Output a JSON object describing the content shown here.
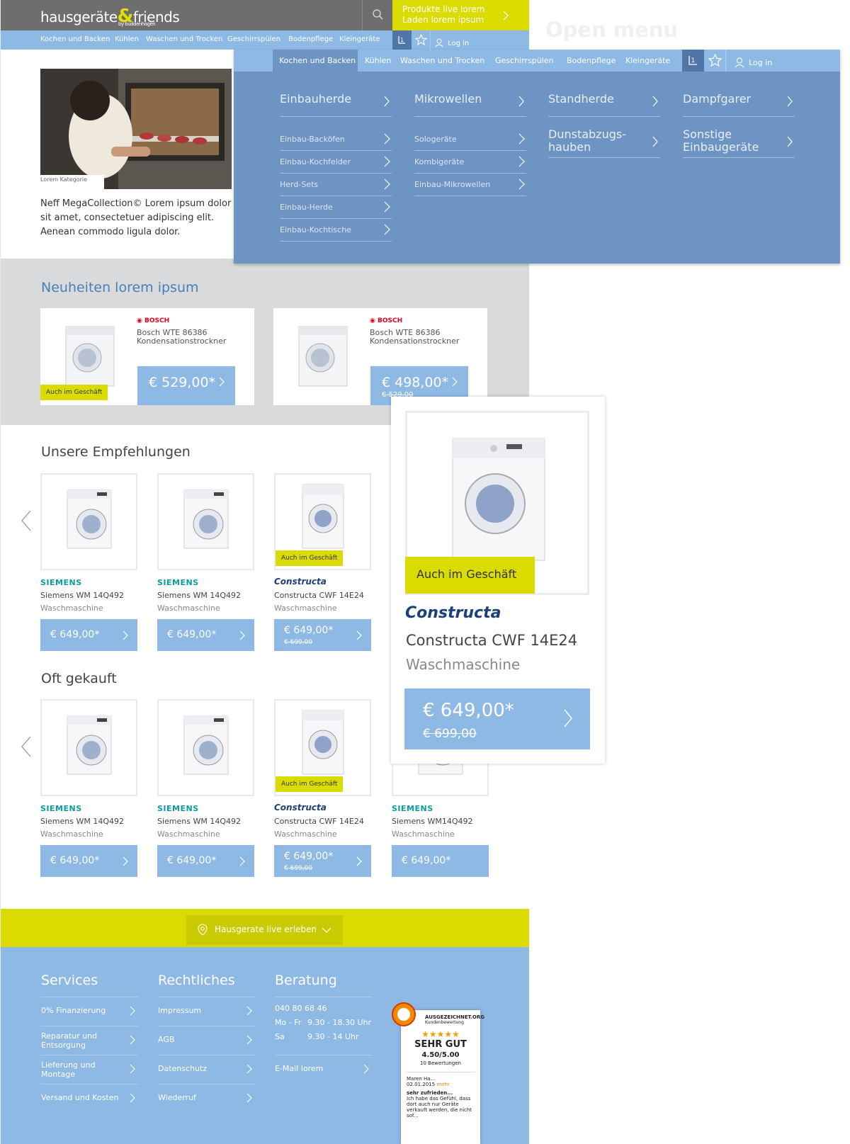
{
  "header": {
    "logo_main": "hausgeräte",
    "logo_amp": "&",
    "logo_friends": "friends",
    "logo_by": "by buddenhagen",
    "promo_line1": "Produkte live lorem",
    "promo_line2": "Laden lorem ipsum",
    "nav": [
      "Kochen und Backen",
      "Kühlen",
      "Waschen und Trocken",
      "Geschirrspülen",
      "Bodenpflege",
      "Kleingeräte"
    ],
    "login": "Log in"
  },
  "hero": {
    "caption": "Lorem Kategorie",
    "text": "Neff MegaCollection© Lorem ipsum dolor sit amet, consectetuer adipiscing elit. Aenean commodo ligula dolor."
  },
  "neuheiten": {
    "title": "Neuheiten lorem ipsum",
    "items": [
      {
        "brand": "BOSCH",
        "name": "Bosch WTE 86386",
        "type": "Kondensationstrockner",
        "price": "€ 529,00*",
        "old": "",
        "badge": "Auch im Geschäft"
      },
      {
        "brand": "BOSCH",
        "name": "Bosch WTE 86386",
        "type": "Kondensationstrockner",
        "price": "€ 498,00*",
        "old": "€ 529,00",
        "badge": ""
      }
    ]
  },
  "empfehlungen": {
    "title": "Unsere Empfehlungen",
    "items": [
      {
        "brand": "SIEMENS",
        "name": "Siemens WM 14Q492",
        "cat": "Waschmaschine",
        "price": "€ 649,00*",
        "old": ""
      },
      {
        "brand": "SIEMENS",
        "name": "Siemens WM 14Q492",
        "cat": "Waschmaschine",
        "price": "€ 649,00*",
        "old": ""
      },
      {
        "brand": "Constructa",
        "name": "Constructa CWF 14E24",
        "cat": "Waschmaschine",
        "price": "€ 649,00*",
        "old": "€ 699,00",
        "badge": "Auch im Geschäft"
      }
    ]
  },
  "oft": {
    "title": "Oft gekauft",
    "items": [
      {
        "brand": "SIEMENS",
        "name": "Siemens WM 14Q492",
        "cat": "Waschmaschine",
        "price": "€ 649,00*",
        "old": ""
      },
      {
        "brand": "SIEMENS",
        "name": "Siemens WM 14Q492",
        "cat": "Waschmaschine",
        "price": "€ 649,00*",
        "old": ""
      },
      {
        "brand": "Constructa",
        "name": "Constructa CWF 14E24",
        "cat": "Waschmaschine",
        "price": "€ 649,00*",
        "old": "€ 699,00",
        "badge": "Auch im Geschäft"
      },
      {
        "brand": "SIEMENS",
        "name": "Siemens WM14Q492",
        "cat": "Waschmaschine",
        "price": "€ 649,00*",
        "old": ""
      }
    ]
  },
  "live_button": "Hausgerate live erleben",
  "footer": {
    "services": {
      "title": "Services",
      "links": [
        "0% Finanzierung",
        "Reparatur und Entsorgung",
        "Lieferung und Montage",
        "Versand und Kosten"
      ]
    },
    "recht": {
      "title": "Rechtliches",
      "links": [
        "Impressum",
        "AGB",
        "Datenschutz",
        "Wiederruf"
      ]
    },
    "beratung": {
      "title": "Beratung",
      "phone": "040 80 68 46",
      "mofr_label": "Mo - Fr",
      "mofr_time": "9.30 - 18.30 Uhr",
      "sa_label": "Sa",
      "sa_time": "9.30 - 14 Uhr",
      "email": "E-Mail lorem"
    },
    "seal": {
      "title": "AUSGEZEICHNET.ORG",
      "subtitle": "Kundenbewertung",
      "grade": "SEHR GUT",
      "score": "4.50/5.00",
      "count": "10 Bewertungen",
      "reviewer": "Maren Ha...",
      "date": "02.01.2015",
      "more": "mehr",
      "review_title": "sehr zufrieden...",
      "review_text": "Ich habe das Gefühl, dass dort auch nur Geräte verkauft werden, die nicht sof..."
    }
  },
  "side": {
    "open_menu_title": "Open menu"
  },
  "mega": {
    "nav": [
      "Kochen und Backen",
      "Kühlen",
      "Waschen und Trocken",
      "Geschirrspülen",
      "Bodenpflege",
      "Kleingeräte"
    ],
    "login": "Log in",
    "col1": {
      "head": "Einbauherde",
      "subs": [
        "Einbau-Backöfen",
        "Einbau-Kochfelder",
        "Herd-Sets",
        "Einbau-Herde",
        "Einbau-Kochtische"
      ]
    },
    "col2": {
      "head": "Mikrowellen",
      "subs": [
        "Sologeräte",
        "Kombigeräte",
        "Einbau-Mikrowellen"
      ]
    },
    "col3": {
      "head": "Standherde",
      "head2_l1": "Dunstabzugs-",
      "head2_l2": "hauben"
    },
    "col4": {
      "head": "Dampfgarer",
      "head2_l1": "Sonstige",
      "head2_l2": "Einbaugeräte"
    }
  },
  "zoom": {
    "badge": "Auch im Geschäft",
    "brand": "Constructa",
    "name": "Constructa CWF 14E24",
    "cat": "Waschmaschine",
    "price": "€ 649,00*",
    "old": "€ 699,00"
  }
}
